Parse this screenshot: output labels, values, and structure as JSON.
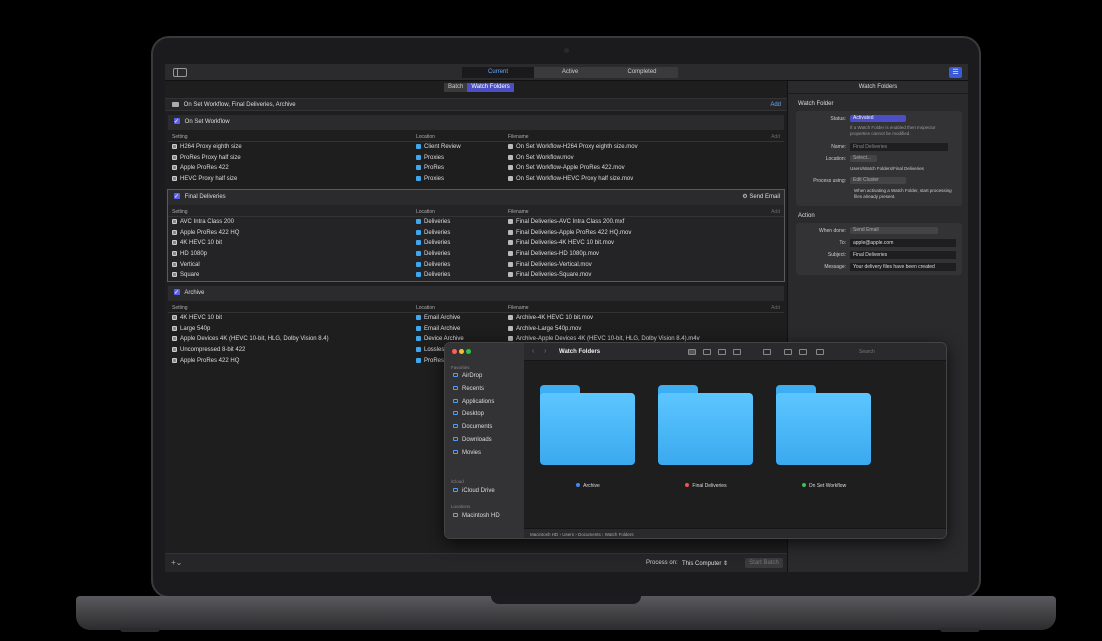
{
  "compressor": {
    "view_tabs": [
      "Current",
      "Active",
      "Completed"
    ],
    "active_view_tab": "Current",
    "sub_tabs": [
      "Batch",
      "Watch Folders"
    ],
    "active_sub_tab": "Watch Folders",
    "header_title": "On Set Workflow, Final Deliveries, Archive",
    "add_label": "Add",
    "columns": [
      "Setting",
      "Location",
      "Filename"
    ],
    "groups": [
      {
        "name": "On Set Workflow",
        "rows": [
          {
            "setting": "H264 Proxy eighth size",
            "location": "Client Review",
            "filename": "On Set Workflow-H264 Proxy eighth size.mov"
          },
          {
            "setting": "ProRes Proxy half size",
            "location": "Proxies",
            "filename": "On Set Workflow.mov"
          },
          {
            "setting": "Apple ProRes 422",
            "location": "ProRes",
            "filename": "On Set Workflow-Apple ProRes 422.mov"
          },
          {
            "setting": "HEVC Proxy half size",
            "location": "Proxies",
            "filename": "On Set Workflow-HEVC Proxy half size.mov"
          }
        ]
      },
      {
        "name": "Final Deliveries",
        "action": "Send Email",
        "rows": [
          {
            "setting": "AVC Intra Class 200",
            "location": "Deliveries",
            "filename": "Final Deliveries-AVC Intra Class 200.mxf"
          },
          {
            "setting": "Apple ProRes 422 HQ",
            "location": "Deliveries",
            "filename": "Final Deliveries-Apple ProRes 422 HQ.mov"
          },
          {
            "setting": "4K HEVC 10 bit",
            "location": "Deliveries",
            "filename": "Final Deliveries-4K HEVC 10 bit.mov"
          },
          {
            "setting": "HD 1080p",
            "location": "Deliveries",
            "filename": "Final Deliveries-HD 1080p.mov"
          },
          {
            "setting": "Vertical",
            "location": "Deliveries",
            "filename": "Final Deliveries-Vertical.mov"
          },
          {
            "setting": "Square",
            "location": "Deliveries",
            "filename": "Final Deliveries-Square.mov"
          }
        ]
      },
      {
        "name": "Archive",
        "rows": [
          {
            "setting": "4K HEVC 10 bit",
            "location": "Email Archive",
            "filename": "Archive-4K HEVC 10 bit.mov"
          },
          {
            "setting": "Large 540p",
            "location": "Email Archive",
            "filename": "Archive-Large 540p.mov"
          },
          {
            "setting": "Apple Devices 4K (HEVC 10-bit, HLG, Dolby Vision 8.4)",
            "location": "Device Archive",
            "filename": "Archive-Apple Devices 4K (HEVC 10-bit, HLG, Dolby Vision 8.4).m4v"
          },
          {
            "setting": "Uncompressed 8-bit 422",
            "location": "Lossless",
            "filename": ""
          },
          {
            "setting": "Apple ProRes 422 HQ",
            "location": "ProRes",
            "filename": ""
          }
        ]
      }
    ],
    "process_on_label": "Process on:",
    "process_on_value": "This Computer",
    "start_batch": "Start Batch"
  },
  "inspector": {
    "title": "Watch Folders",
    "watch_folder_section": "Watch Folder",
    "status_label": "Status:",
    "status_value": "Activated",
    "status_note": "If a Watch Folder is enabled then Inspector properties cannot be modified.",
    "name_label": "Name:",
    "name_value": "Final Deliveries",
    "location_label": "Location:",
    "location_button": "Select...",
    "location_path": "Users/Watch Folders/Final Deliveries",
    "process_using_label": "Process using:",
    "process_using_value": "Edit Cluster",
    "process_check_note": "When activating a Watch Folder, start processing files already present.",
    "action_section": "Action",
    "when_done_label": "When done:",
    "when_done_value": "Send Email",
    "to_label": "To:",
    "to_value": "apple@apple.com",
    "subject_label": "Subject:",
    "subject_value": "Final Deliveries",
    "message_label": "Message:",
    "message_value": "Your delivery files have been created"
  },
  "finder": {
    "title": "Watch Folders",
    "search_placeholder": "Search",
    "favorites_header": "Favorites",
    "favorites": [
      "AirDrop",
      "Recents",
      "Applications",
      "Desktop",
      "Documents",
      "Downloads",
      "Movies"
    ],
    "icloud_header": "iCloud",
    "icloud_items": [
      "iCloud Drive"
    ],
    "locations_header": "Locations",
    "location_items": [
      "Macintosh HD"
    ],
    "folders": [
      {
        "name": "Archive",
        "tag_color": "#3b8cf5"
      },
      {
        "name": "Final Deliveries",
        "tag_color": "#f0524d"
      },
      {
        "name": "On Set Workflow",
        "tag_color": "#37c35a"
      }
    ],
    "path": [
      "Macintosh HD",
      "Users",
      "Documents",
      "Watch Folders"
    ]
  }
}
